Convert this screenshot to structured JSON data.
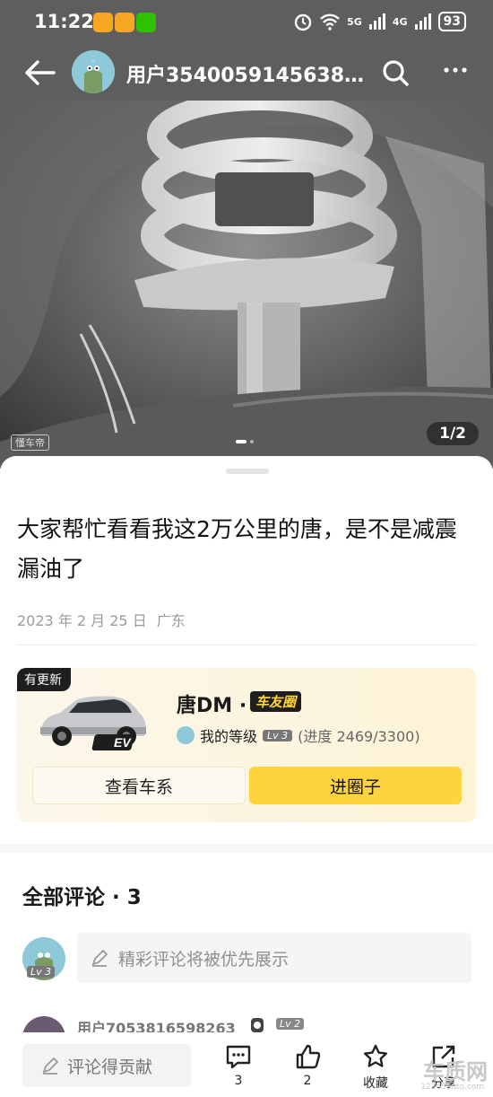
{
  "status": {
    "time": "11:22",
    "signal_a": "5G",
    "signal_b": "4G",
    "battery": "93"
  },
  "header": {
    "username": "用户3540059145638..."
  },
  "gallery": {
    "counter": "1/2",
    "watermark": "懂车帝"
  },
  "post": {
    "title": "大家帮忙看看我这2万公里的唐，是不是减震漏油了",
    "date": "2023 年 2 月 25 日",
    "location": "广东"
  },
  "car_card": {
    "badge": "有更新",
    "ev_tag": "EV",
    "series": "唐DM",
    "separator": "·",
    "circle_tag": "车友圈",
    "level_label": "我的等级",
    "level": "Lv 3",
    "progress_text": "(进度 2469/3300)",
    "progress": {
      "current": 2469,
      "total": 3300
    },
    "btn_series": "查看车系",
    "btn_join": "进圈子"
  },
  "comments": {
    "heading": "全部评论 · 3",
    "my_level": "Lv 3",
    "input_placeholder": "精彩评论将被优先展示",
    "first_user": "用户7053816598263",
    "first_user_level": "Lv 2"
  },
  "bottom_bar": {
    "contrib_label": "评论得贡献",
    "comment_count": "3",
    "like_count": "2",
    "favorite_label": "收藏",
    "share_label": "分享",
    "logo_text": "车质网",
    "logo_sub": "12365auto.com"
  },
  "colors": {
    "accent_yellow": "#fdd43d",
    "header_bg": "#5e5e5e"
  }
}
